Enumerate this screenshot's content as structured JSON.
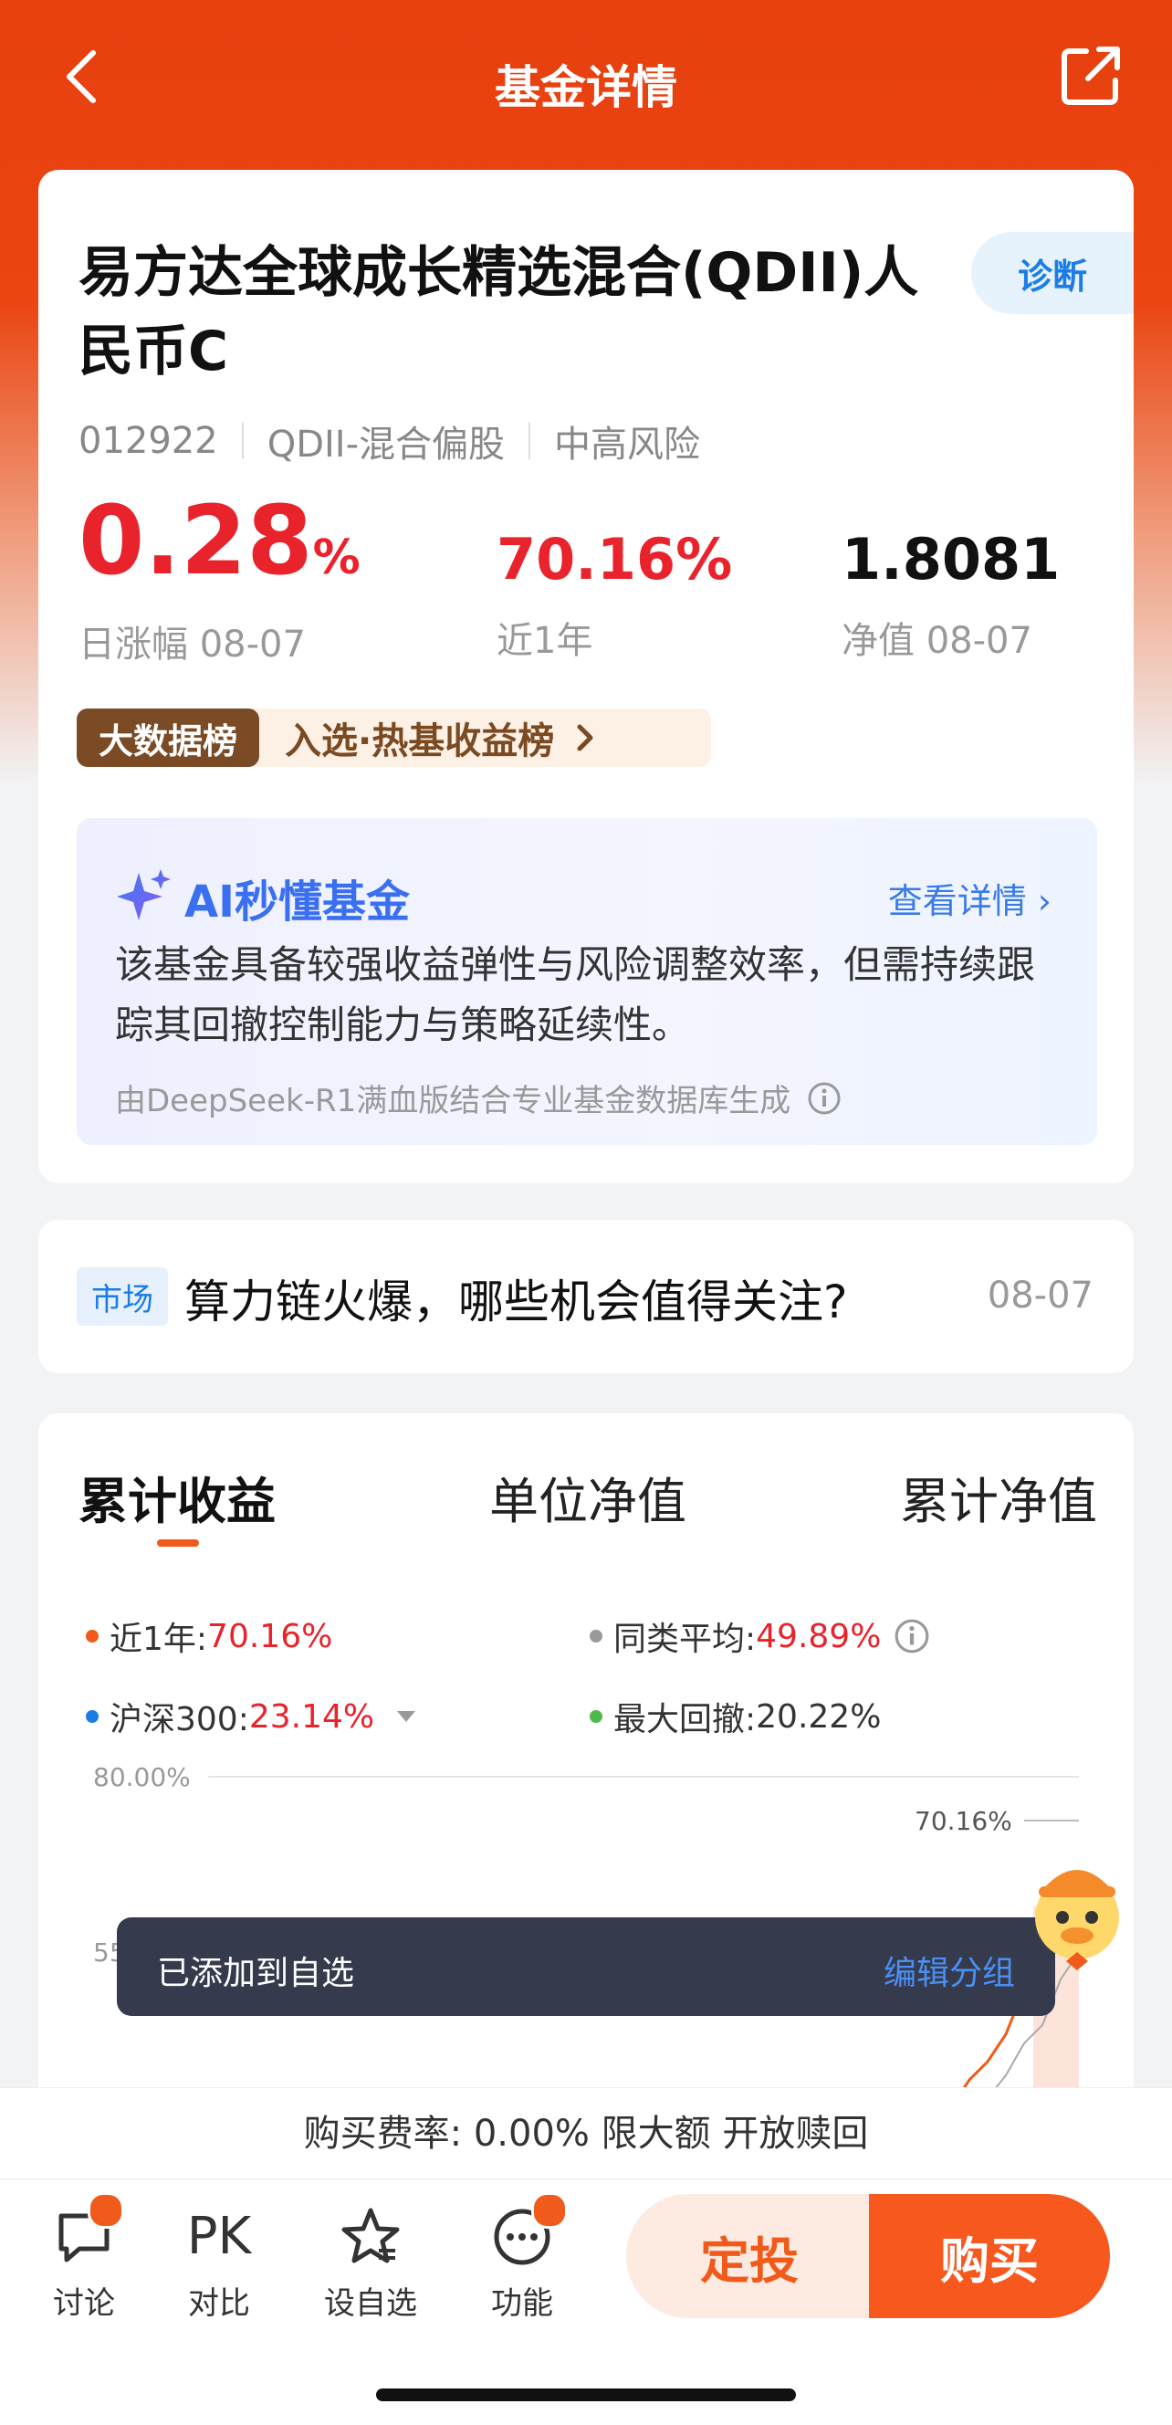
{
  "header": {
    "title": "基金详情",
    "back_icon": "chevron-left-icon",
    "share_icon": "share-icon"
  },
  "fund": {
    "name": "易方达全球成长精选混合(QDII)人民币C",
    "diagnose_label": "诊断",
    "code": "012922",
    "type": "QDII-混合偏股",
    "risk": "中高风险",
    "stats": {
      "daily_value": "0.28",
      "daily_unit": "%",
      "daily_label": "日涨幅 08-07",
      "year_value": "70.16%",
      "year_label": "近1年",
      "nav_value": "1.8081",
      "nav_label": "净值 08-07"
    },
    "rank_badge": "大数据榜",
    "rank_text": "入选·热基收益榜"
  },
  "ai": {
    "title": "AI秒懂基金",
    "more": "查看详情",
    "body": "该基金具备较强收益弹性与风险调整效率，但需持续跟踪其回撤控制能力与策略延续性。",
    "footer": "由DeepSeek-R1满血版结合专业基金数据库生成"
  },
  "market": {
    "tag": "市场",
    "title": "算力链火爆，哪些机会值得关注?",
    "date": "08-07"
  },
  "tabs": [
    "累计收益",
    "单位净值",
    "累计净值"
  ],
  "legend": {
    "year_label": "近1年:",
    "year_value": "70.16%",
    "avg_label": "同类平均:",
    "avg_value": "49.89%",
    "hs300_label": "沪深300:",
    "hs300_value": "23.14%",
    "dd_label": "最大回撤:",
    "dd_value": "20.22%"
  },
  "chart_data": {
    "type": "line",
    "y_ticks": [
      "80.00%",
      "55"
    ],
    "end_label": "70.16%",
    "series": [
      {
        "name": "近1年",
        "color": "#f05a1a",
        "end_value": 70.16
      },
      {
        "name": "同类平均",
        "color": "#999999",
        "end_value": 49.89
      },
      {
        "name": "沪深300",
        "color": "#1b7de5",
        "end_value": 23.14
      }
    ]
  },
  "toast": {
    "message": "已添加到自选",
    "action": "编辑分组"
  },
  "fee": "购买费率: 0.00% 限大额 开放赎回",
  "bottom": {
    "discuss": "讨论",
    "compare_icon_text": "PK",
    "compare": "对比",
    "watch": "设自选",
    "more": "功能",
    "fixed_invest": "定投",
    "buy": "购买"
  },
  "colors": {
    "brand": "#e8400f",
    "up_red": "#e8232c",
    "accent": "#f7581d"
  }
}
